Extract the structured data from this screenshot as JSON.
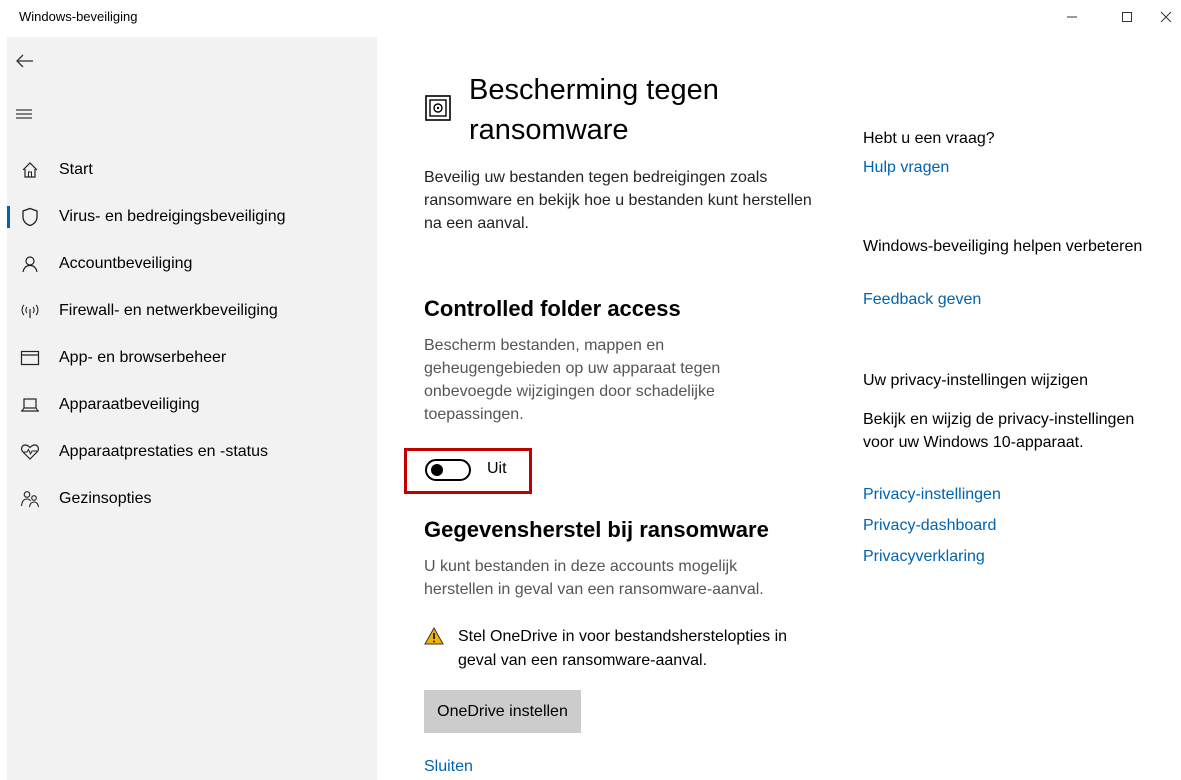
{
  "window": {
    "title": "Windows-beveiliging"
  },
  "sidebar": {
    "items": [
      {
        "label": "Start",
        "icon": "home-icon"
      },
      {
        "label": "Virus- en bedreigingsbeveiliging",
        "icon": "shield-icon",
        "active": true
      },
      {
        "label": "Accountbeveiliging",
        "icon": "person-icon"
      },
      {
        "label": "Firewall- en netwerkbeveiliging",
        "icon": "wireless-icon"
      },
      {
        "label": "App- en browserbeheer",
        "icon": "browser-window-icon"
      },
      {
        "label": "Apparaatbeveiliging",
        "icon": "laptop-icon"
      },
      {
        "label": "Apparaatprestaties en -status",
        "icon": "heart-pulse-icon"
      },
      {
        "label": "Gezinsopties",
        "icon": "family-icon"
      }
    ]
  },
  "main": {
    "title": "Bescherming tegen ransomware",
    "description": "Beveilig uw bestanden tegen bedreigingen zoals ransomware en bekijk hoe u bestanden kunt herstellen na een aanval.",
    "cfa": {
      "title": "Controlled folder access",
      "description": "Bescherm bestanden, mappen en geheugengebieden op uw apparaat tegen onbevoegde wijzigingen door schadelijke toepassingen.",
      "toggle_label": "Uit",
      "toggle_on": false
    },
    "recovery": {
      "title": "Gegevensherstel bij ransomware",
      "description": "U kunt bestanden in deze accounts mogelijk herstellen in geval van een ransomware-aanval.",
      "warning": "Stel OneDrive in voor bestandsherstelopties in geval van een ransomware-aanval.",
      "button_label": "OneDrive instellen",
      "close_link": "Sluiten"
    }
  },
  "right": {
    "question_heading": "Hebt u een vraag?",
    "help_link": "Hulp vragen",
    "improve_heading": "Windows-beveiliging helpen verbeteren",
    "feedback_link": "Feedback geven",
    "privacy_heading": "Uw privacy-instellingen wijzigen",
    "privacy_text": "Bekijk en wijzig de privacy-instellingen voor uw Windows 10-apparaat.",
    "privacy_links": [
      "Privacy-instellingen",
      "Privacy-dashboard",
      "Privacyverklaring"
    ]
  },
  "colors": {
    "accent": "#0063b1",
    "highlight_frame": "#c00000",
    "warning": "#f2b400",
    "sidebar_bg": "#f2f2f2",
    "button_bg": "#cccccc"
  }
}
